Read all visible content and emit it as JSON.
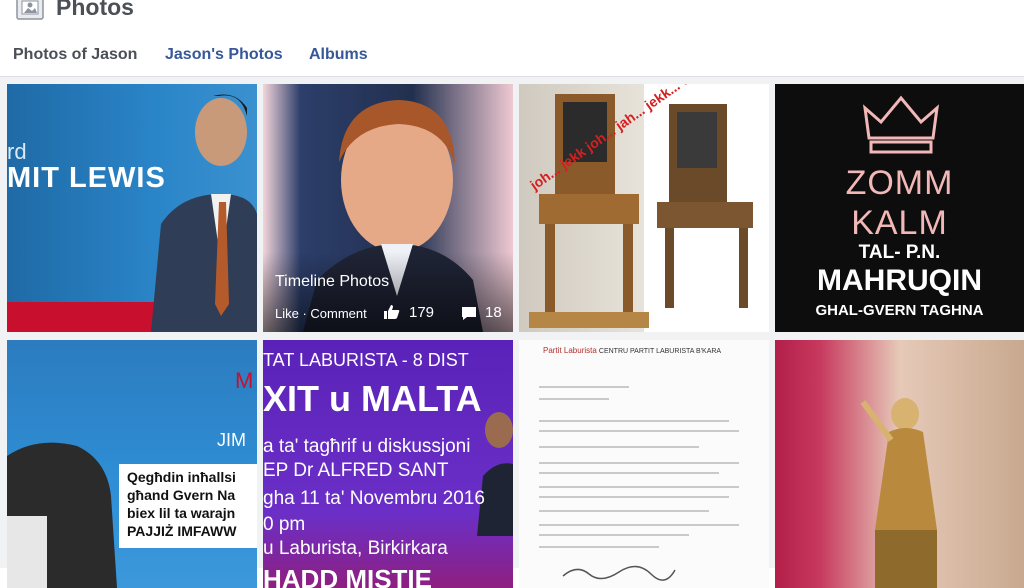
{
  "header": {
    "title": "Photos",
    "title_icon": "photos-icon"
  },
  "tabs": [
    {
      "label": "Photos of Jason",
      "active": true
    },
    {
      "label": "Jason's Photos",
      "active": false
    },
    {
      "label": "Albums",
      "active": false
    }
  ],
  "tiles": {
    "t1": {
      "text_rd": "rd",
      "text_name": "MIT LEWIS"
    },
    "t2": {
      "album_label": "Timeline Photos",
      "actions_text": "Like · Comment",
      "like_count": "179",
      "comment_count": "18",
      "like_icon": "thumbs-up-icon",
      "comment_icon": "comment-icon"
    },
    "t3": {
      "stamp_text": "joh... jekk joh... jah... jekk... dawn"
    },
    "t4": {
      "line1": "ZOMM",
      "line2": "KALM",
      "line3": "TAL- P.N.",
      "line4": "MAHRUQIN",
      "line5": "GHAL-GVERN TAGHNA"
    },
    "t5": {
      "m_text": "M",
      "jim_text": "JIM",
      "caption_lines": [
        "Qegħdin inħallsi",
        "għand Gvern Na",
        "biex lil ta warajn",
        "PAJJIŻ IMFAWW"
      ]
    },
    "t6": {
      "top": "TAT LABURISTA - 8 DIST",
      "big": "XIT u MALTA",
      "r1": "a ta' tagħrif u diskussjoni",
      "r2": "EP Dr ALFRED SANT",
      "r3": "gha 11 ta' Novembru 2016",
      "r4": "0 pm",
      "r5": "u Laburista, Birkirkara",
      "bottom": "HADD MISTIE"
    },
    "t7": {
      "logo_text": "Partit Laburista",
      "head_text": "CENTRU PARTIT LABURISTA B'KARA"
    }
  },
  "colors": {
    "link": "#365899",
    "title": "#4b4f56",
    "divider": "#dddfe2"
  }
}
